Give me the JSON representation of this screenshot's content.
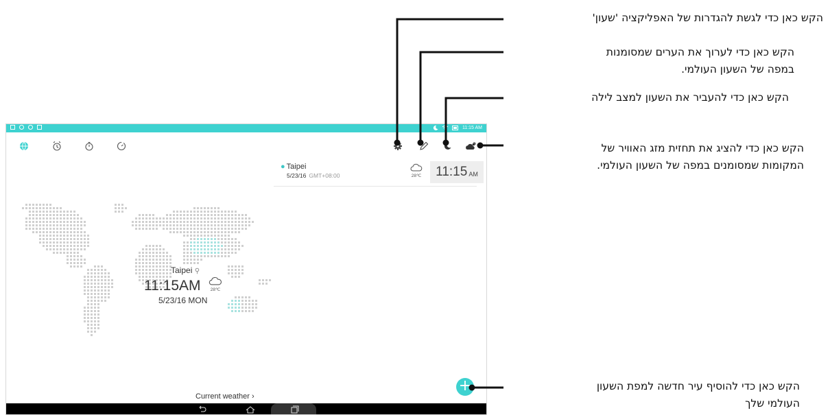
{
  "status_bar": {
    "time": "11:15 AM"
  },
  "tabs": [
    {
      "name": "world-clock",
      "icon": "globe-icon"
    },
    {
      "name": "alarm",
      "icon": "alarm-clock-icon"
    },
    {
      "name": "stopwatch",
      "icon": "stopwatch-icon"
    },
    {
      "name": "timer",
      "icon": "timer-icon"
    }
  ],
  "actions": [
    {
      "name": "settings",
      "icon": "gear-icon"
    },
    {
      "name": "edit",
      "icon": "pencil-icon"
    },
    {
      "name": "night-mode",
      "icon": "moon-icon"
    },
    {
      "name": "weather",
      "icon": "cloud-sun-icon"
    }
  ],
  "city_card": {
    "city": "Taipei",
    "date": "5/23/16",
    "gmt": "GMT+08:00",
    "temp": "28℃",
    "time": "11:15",
    "ampm": "AM"
  },
  "map": {
    "city": "Taipei",
    "time": "11:15AM",
    "temp": "28℃",
    "date": "5/23/16 MON"
  },
  "current_weather_label": "Current weather",
  "accent_color": "#3ed2d0",
  "callouts": {
    "settings": "הקש כאן כדי לגשת להגדרות של האפליקציה 'שעון'",
    "edit_line1": "הקש כאן כדי לערוך את הערים שמסומנות",
    "edit_line2": "במפה של השעון העולמי.",
    "night": "הקש כאן כדי להעביר את השעון למצב לילה",
    "weather_line1": "הקש כאן כדי להציג את תחזית מזג האוויר של",
    "weather_line2": "המקומות שמסומנים במפה של השעון העולמי.",
    "add_line1": "הקש כאן כדי להוסיף עיר חדשה למפת השעון",
    "add_line2": "העולמי שלך"
  }
}
